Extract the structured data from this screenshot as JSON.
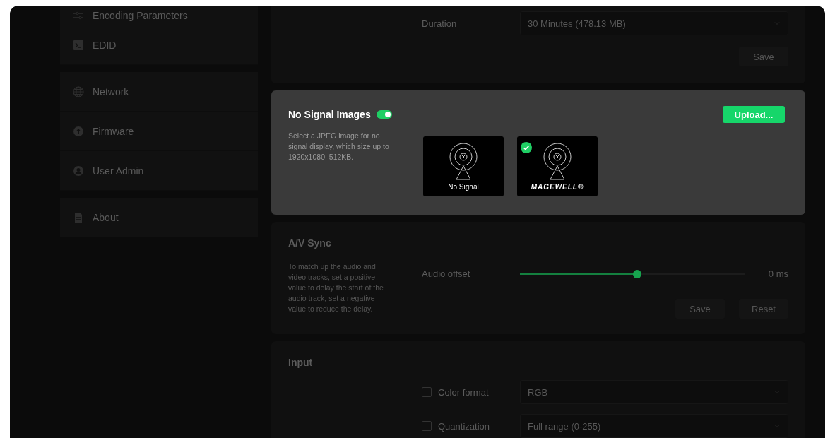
{
  "sidebar": {
    "groups": [
      {
        "items": [
          {
            "label": "Encoding Parameters"
          },
          {
            "label": "EDID"
          }
        ]
      },
      {
        "items": [
          {
            "label": "Network"
          },
          {
            "label": "Firmware"
          },
          {
            "label": "User Admin"
          }
        ]
      },
      {
        "items": [
          {
            "label": "About"
          }
        ]
      }
    ]
  },
  "duration_card": {
    "label": "Duration",
    "value": "30 Minutes (478.13 MB)",
    "button": "Save"
  },
  "no_signal_card": {
    "title": "No Signal Images",
    "enabled": true,
    "description": "Select a JPEG image for no signal display, which size up to 1920x1080, 512KB.",
    "upload_button": "Upload...",
    "images": [
      {
        "caption": "No Signal",
        "kind": "text",
        "selected": false
      },
      {
        "caption": "MAGEWELL®",
        "kind": "logo",
        "selected": true
      }
    ]
  },
  "av_sync_card": {
    "title": "A/V Sync",
    "description": "To match up the audio and video tracks, set a positive value to delay the start of the audio track, set a negative value to reduce the delay.",
    "label": "Audio offset",
    "level": 0.52,
    "reading": "0 ms",
    "buttons": [
      "Save",
      "Reset"
    ]
  },
  "input_card": {
    "title": "Input",
    "rows": [
      {
        "label": "Color format",
        "checked": false,
        "value": "RGB"
      },
      {
        "label": "Quantization",
        "checked": false,
        "value": "Full range (0-255)"
      }
    ]
  }
}
